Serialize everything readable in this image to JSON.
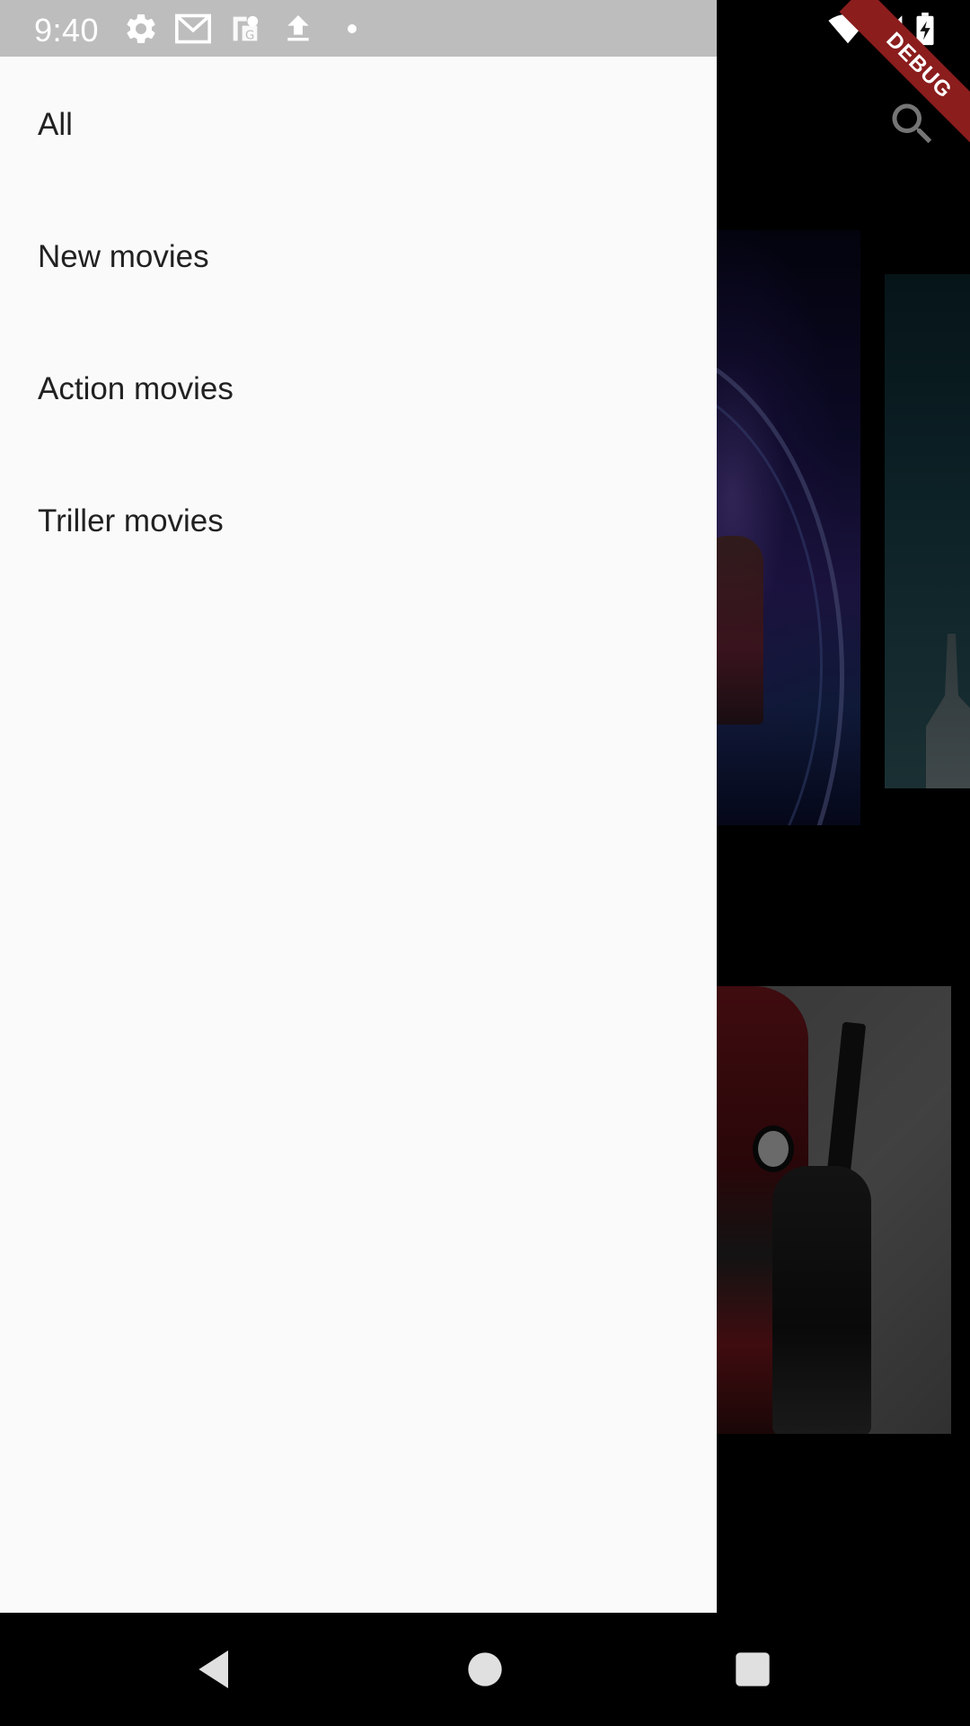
{
  "status_bar": {
    "time": "9:40",
    "left_icons": [
      "gear-icon",
      "mail-icon",
      "maps-icon",
      "upload-icon",
      "dot-icon"
    ],
    "right_icons": [
      "wifi-icon",
      "signal-icon",
      "battery-charging-icon"
    ]
  },
  "debug_banner": {
    "label": "DEBUG",
    "color": "#8b1d1d"
  },
  "app_bar": {
    "search_icon": "search-icon"
  },
  "drawer": {
    "items": [
      {
        "label": "All"
      },
      {
        "label": "New movies"
      },
      {
        "label": "Action movies"
      },
      {
        "label": "Triller movies"
      }
    ]
  },
  "nav_bar": {
    "buttons": [
      "back-icon",
      "home-icon",
      "recents-icon"
    ]
  },
  "colors": {
    "drawer_bg": "#fafafa",
    "status_bar_bg": "#bdbdbd",
    "text": "#212121"
  }
}
